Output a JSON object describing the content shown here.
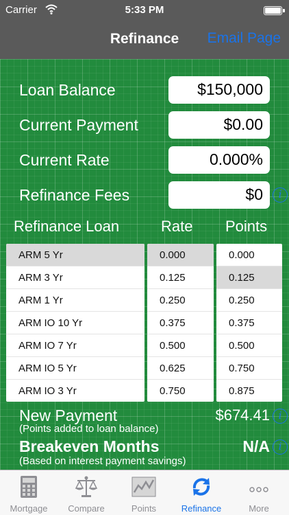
{
  "status_bar": {
    "carrier": "Carrier",
    "time": "5:33 PM"
  },
  "nav": {
    "title": "Refinance",
    "email_label": "Email Page"
  },
  "inputs": {
    "loan_balance": {
      "label": "Loan Balance",
      "value": "$150,000"
    },
    "current_payment": {
      "label": "Current Payment",
      "value": "$0.00"
    },
    "current_rate": {
      "label": "Current Rate",
      "value": "0.000%"
    },
    "refinance_fees": {
      "label": "Refinance Fees",
      "value": "$0"
    }
  },
  "columns": {
    "loan": "Refinance Loan",
    "rate": "Rate",
    "points": "Points"
  },
  "loans": [
    "ARM 5 Yr",
    "ARM 3 Yr",
    "ARM 1 Yr",
    "ARM IO 10 Yr",
    "ARM IO 7 Yr",
    "ARM IO 5 Yr",
    "ARM IO 3 Yr"
  ],
  "rates": [
    "0.000",
    "0.125",
    "0.250",
    "0.375",
    "0.500",
    "0.625",
    "0.750"
  ],
  "points": [
    "0.000",
    "0.125",
    "0.250",
    "0.375",
    "0.500",
    "0.750",
    "0.875"
  ],
  "selected": {
    "loan": "ARM 5 Yr",
    "rate": "0.000",
    "points": "0.125"
  },
  "results": {
    "new_payment_label": "New Payment",
    "new_payment_value": "$674.41",
    "new_payment_note": "(Points added to loan balance)",
    "breakeven_label": "Breakeven Months",
    "breakeven_value": "N/A",
    "breakeven_note": "(Based on interest payment savings)"
  },
  "info_icon_glyph": "i",
  "tabs": [
    {
      "label": "Mortgage",
      "icon": "calculator-icon"
    },
    {
      "label": "Compare",
      "icon": "scale-icon"
    },
    {
      "label": "Points",
      "icon": "chart-icon"
    },
    {
      "label": "Refinance",
      "icon": "refresh-icon",
      "active": true
    },
    {
      "label": "More",
      "icon": "more-icon"
    }
  ],
  "colors": {
    "background": "#228b3d",
    "accent": "#1a73e8",
    "nav": "#5a5a5a"
  }
}
